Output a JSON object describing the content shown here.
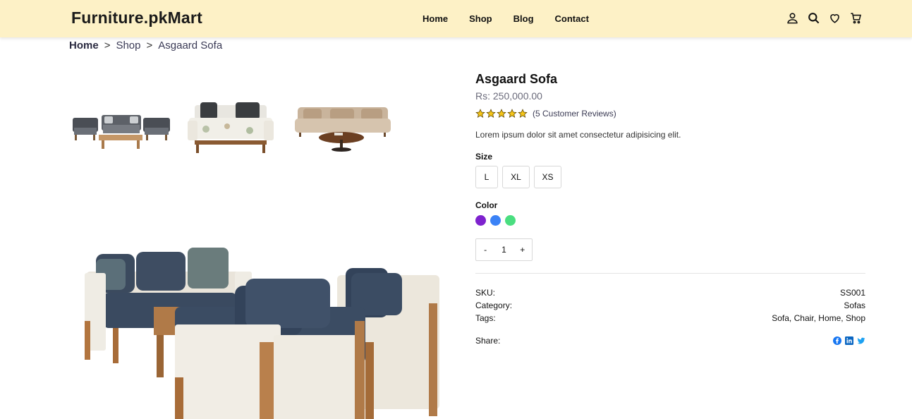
{
  "header": {
    "brand": "Furniture.pkMart",
    "nav": [
      "Home",
      "Shop",
      "Blog",
      "Contact"
    ],
    "icons": [
      "user-icon",
      "search-icon",
      "heart-icon",
      "cart-icon"
    ]
  },
  "breadcrumb": {
    "home": "Home",
    "shop": "Shop",
    "current": "Asgaard Sofa",
    "separator": ">"
  },
  "product": {
    "title": "Asgaard Sofa",
    "price": "Rs: 250,000.00",
    "rating_stars": 5,
    "reviews": "(5 Customer Reviews)",
    "description": "Lorem ipsum dolor sit amet consectetur adipisicing elit.",
    "size_label": "Size",
    "sizes": [
      "L",
      "XL",
      "XS"
    ],
    "color_label": "Color",
    "colors": [
      "#7e22ce",
      "#3b82f6",
      "#4ade80"
    ],
    "quantity": {
      "minus": "-",
      "value": "1",
      "plus": "+"
    },
    "meta": {
      "sku_label": "SKU:",
      "sku": "SS001",
      "category_label": "Category:",
      "category": "Sofas",
      "tags_label": "Tags:",
      "tags": "Sofa, Chair, Home, Shop",
      "share_label": "Share:"
    },
    "share_icons": [
      "facebook-icon",
      "linkedin-icon",
      "twitter-icon"
    ]
  },
  "colors": {
    "header_bg": "#fdf1c6",
    "star": "#f5c518",
    "facebook": "#1877f2",
    "linkedin": "#0a66c2",
    "twitter": "#1da1f2"
  }
}
